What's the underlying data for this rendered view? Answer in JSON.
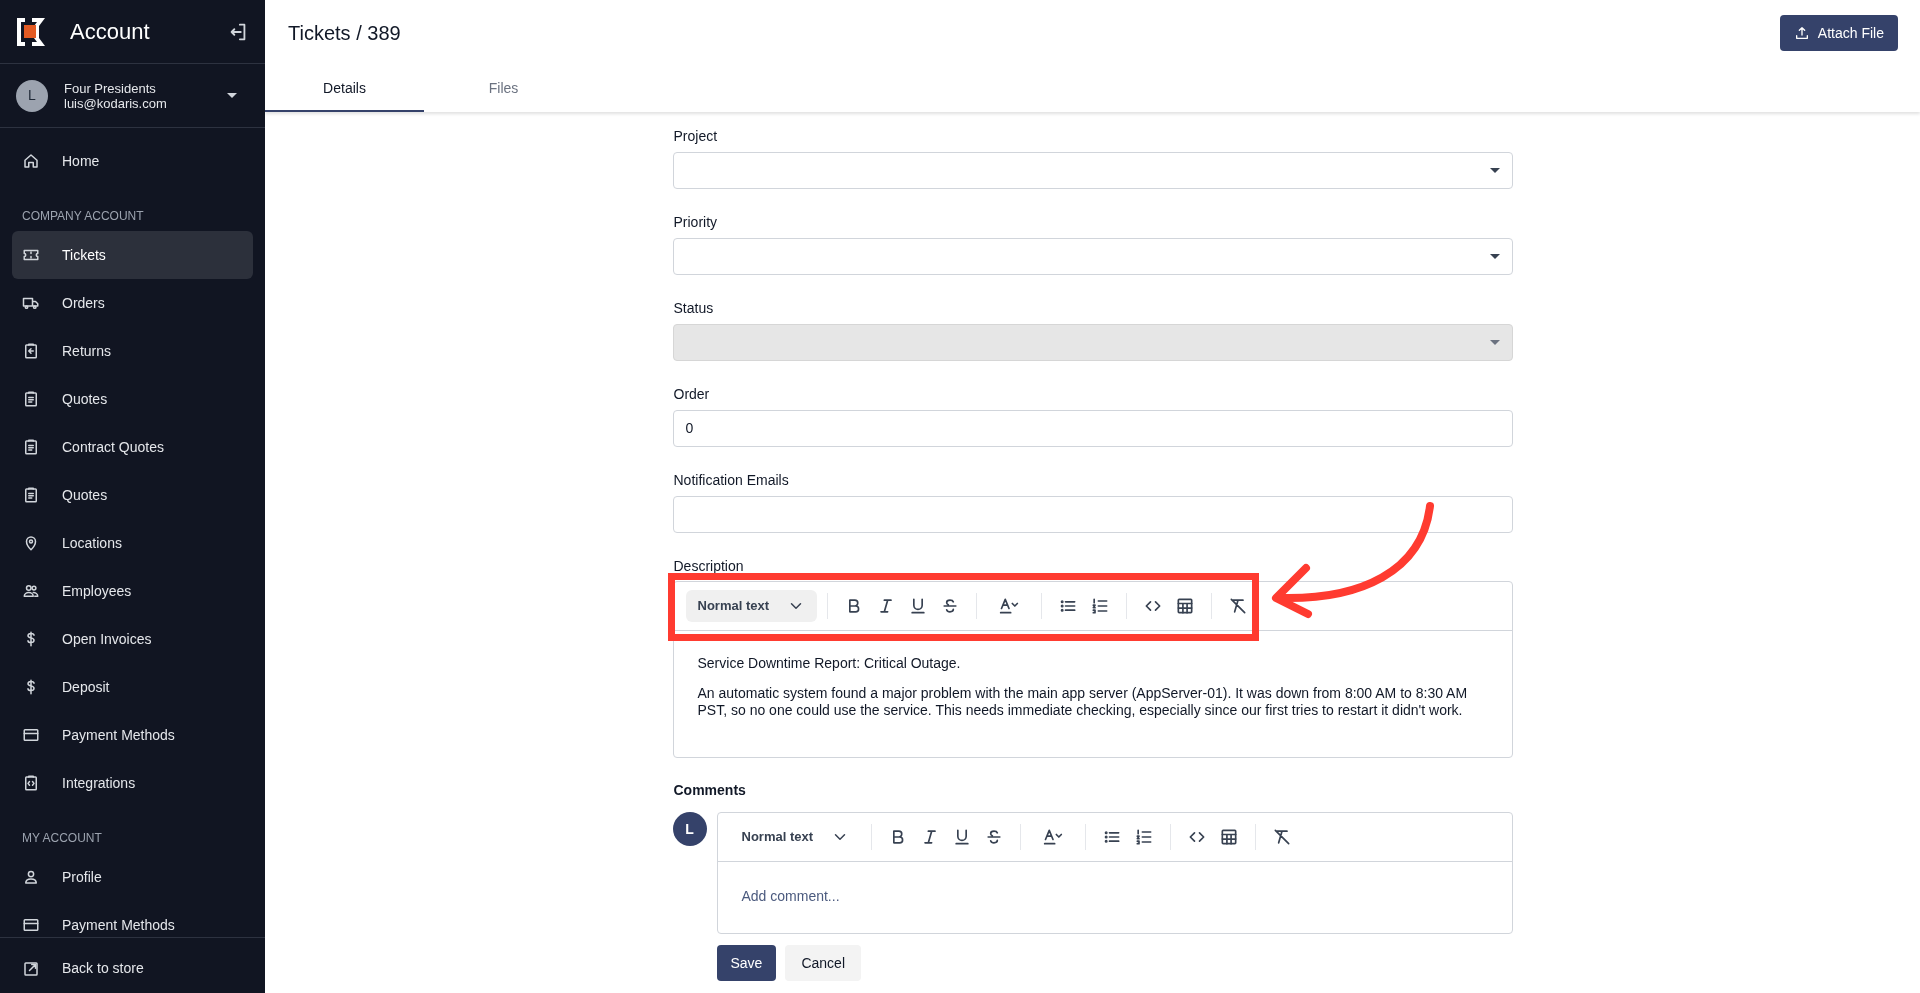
{
  "sidebar": {
    "title": "Account",
    "user": {
      "initial": "L",
      "name": "Four Presidents",
      "email": "luis@kodaris.com"
    },
    "sections": [
      {
        "items": [
          {
            "label": "Home",
            "selected": false
          }
        ]
      },
      {
        "heading": "COMPANY ACCOUNT",
        "items": [
          {
            "label": "Tickets",
            "selected": true
          },
          {
            "label": "Orders",
            "selected": false
          },
          {
            "label": "Returns",
            "selected": false
          },
          {
            "label": "Quotes",
            "selected": false
          },
          {
            "label": "Contract Quotes",
            "selected": false
          },
          {
            "label": "Quotes",
            "selected": false
          },
          {
            "label": "Locations",
            "selected": false
          },
          {
            "label": "Employees",
            "selected": false
          },
          {
            "label": "Open Invoices",
            "selected": false
          },
          {
            "label": "Deposit",
            "selected": false
          },
          {
            "label": "Payment Methods",
            "selected": false
          },
          {
            "label": "Integrations",
            "selected": false
          }
        ]
      },
      {
        "heading": "MY ACCOUNT",
        "items": [
          {
            "label": "Profile",
            "selected": false
          },
          {
            "label": "Payment Methods",
            "selected": false
          }
        ]
      }
    ],
    "footer": {
      "label": "Back to store"
    }
  },
  "header": {
    "title": "Tickets / 389",
    "action": "Attach File",
    "tabs": [
      {
        "label": "Details",
        "selected": true
      },
      {
        "label": "Files",
        "selected": false
      }
    ]
  },
  "form": {
    "fields": [
      {
        "label": "Project",
        "kind": "select",
        "disabled": false
      },
      {
        "label": "Priority",
        "kind": "select",
        "disabled": false
      },
      {
        "label": "Status",
        "kind": "select",
        "disabled": true
      },
      {
        "label": "Order",
        "kind": "input",
        "disabled": false,
        "value": "0"
      },
      {
        "label": "Notification Emails",
        "kind": "input",
        "disabled": false
      }
    ],
    "description": {
      "label": "Description",
      "style_menu": {
        "label": "Normal text",
        "active": true
      },
      "paragraphs": [
        "Service Downtime Report: Critical Outage.",
        "An automatic system found a major problem with the main app server (AppServer-01). It was down from 8:00 AM to 8:30 AM PST, so no one could use the service. This needs immediate checking, especially since our first tries to restart it didn't work."
      ]
    },
    "comments": {
      "heading": "Comments",
      "avatar": "L",
      "style_menu": {
        "label": "Normal text",
        "active": false
      },
      "placeholder": "Add comment...",
      "buttons": [
        "Save",
        "Cancel"
      ]
    }
  }
}
